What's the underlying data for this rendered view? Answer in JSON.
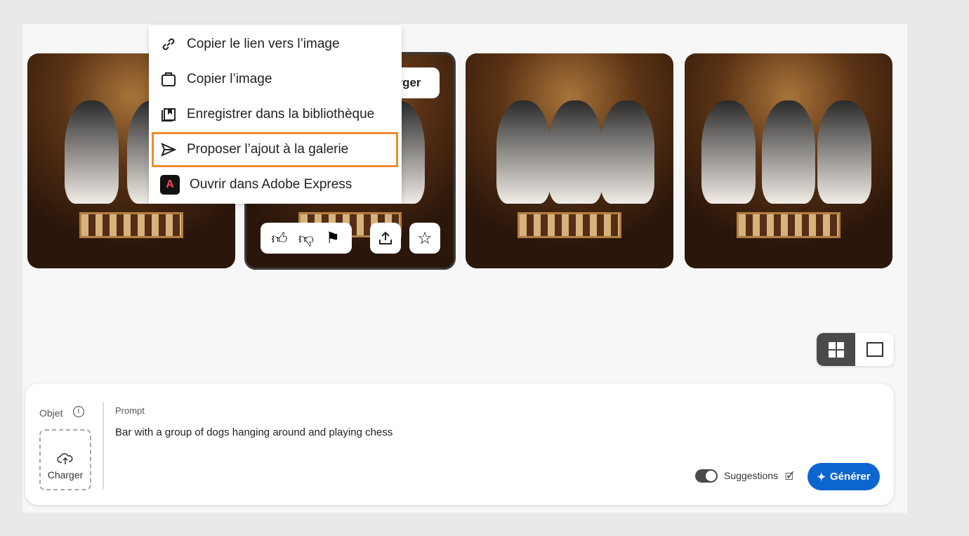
{
  "menu": {
    "items": [
      {
        "label": "Copier le lien vers l’image",
        "icon": "link-icon"
      },
      {
        "label": "Copier l’image",
        "icon": "clipboard-icon"
      },
      {
        "label": "Enregistrer dans la bibliothèque",
        "icon": "library-icon"
      },
      {
        "label": "Proposer l’ajout à la galerie",
        "icon": "send-icon",
        "highlighted": true
      },
      {
        "label": "Ouvrir dans Adobe Express",
        "icon": "adobe-express-icon"
      }
    ]
  },
  "image_card": {
    "download_label": "rger"
  },
  "prompt": {
    "object_label": "Objet",
    "upload_label": "Charger",
    "prompt_label": "Prompt",
    "prompt_text": "Bar with a group of dogs hanging around and playing chess",
    "suggestions_label": "Suggestions",
    "suggestions_on": true,
    "generate_label": "Générer"
  },
  "colors": {
    "accent": "#0d66d0",
    "highlight": "#f08a2c"
  }
}
